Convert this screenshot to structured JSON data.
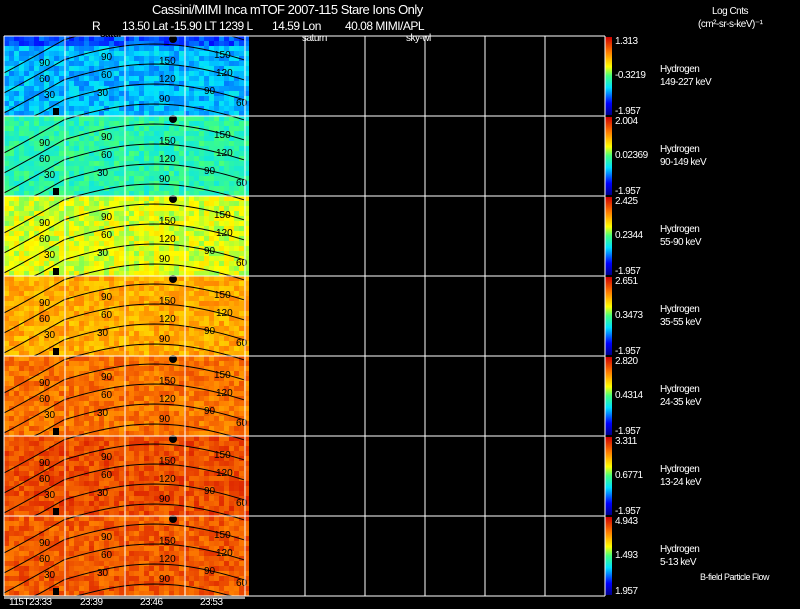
{
  "header": {
    "title": "Cassini/MIMI Inca mTOF  2007-115   Stare   Ions Only",
    "ephemeris_r": "R",
    "ephemeris": "13.50 Lat -15.90 LT 1239 L",
    "lon": "14.59 Lon",
    "lon_value": "40.08  MIMI/APL",
    "units_line1": "Log Cnts",
    "units_line2": "(cm²-sr-s-keV)⁻¹"
  },
  "markers": {
    "satur": "satur",
    "saturn": "saturn",
    "sky": "sky-wl"
  },
  "footer": {
    "flow_label": "B-field Particle Flow"
  },
  "chart_data": {
    "type": "heatmap",
    "title": "Cassini/MIMI Inca mTOF  2007-115   Stare   Ions Only",
    "x_tick_labels": [
      "115T23:33",
      "23:39",
      "23:46",
      "23:53"
    ],
    "contour_labels": [
      "30",
      "60",
      "90",
      "120",
      "150"
    ],
    "colorbar_label": "Log Cnts (cm²-sr-s-keV)⁻¹",
    "panels": [
      {
        "species": "Hydrogen",
        "energy": "149-227 keV",
        "cmax": "1.313",
        "cmid": "-0.3219",
        "cmin": "-1.957",
        "level": 0.32
      },
      {
        "species": "Hydrogen",
        "energy": "90-149 keV",
        "cmax": "2.004",
        "cmid": "0.02369",
        "cmin": "-1.957",
        "level": 0.45
      },
      {
        "species": "Hydrogen",
        "energy": "55-90 keV",
        "cmax": "2.425",
        "cmid": "0.2344",
        "cmin": "-1.957",
        "level": 0.6
      },
      {
        "species": "Hydrogen",
        "energy": "35-55 keV",
        "cmax": "2.651",
        "cmid": "0.3473",
        "cmin": "-1.957",
        "level": 0.74
      },
      {
        "species": "Hydrogen",
        "energy": "24-35 keV",
        "cmax": "2.820",
        "cmid": "0.4314",
        "cmin": "-1.957",
        "level": 0.82
      },
      {
        "species": "Hydrogen",
        "energy": "13-24 keV",
        "cmax": "3.311",
        "cmid": "0.6771",
        "cmin": "-1.957",
        "level": 0.88
      },
      {
        "species": "Hydrogen",
        "energy": "5-13 keV",
        "cmax": "4.943",
        "cmid": "1.493",
        "cmin": "1.957",
        "level": 0.86
      }
    ]
  }
}
